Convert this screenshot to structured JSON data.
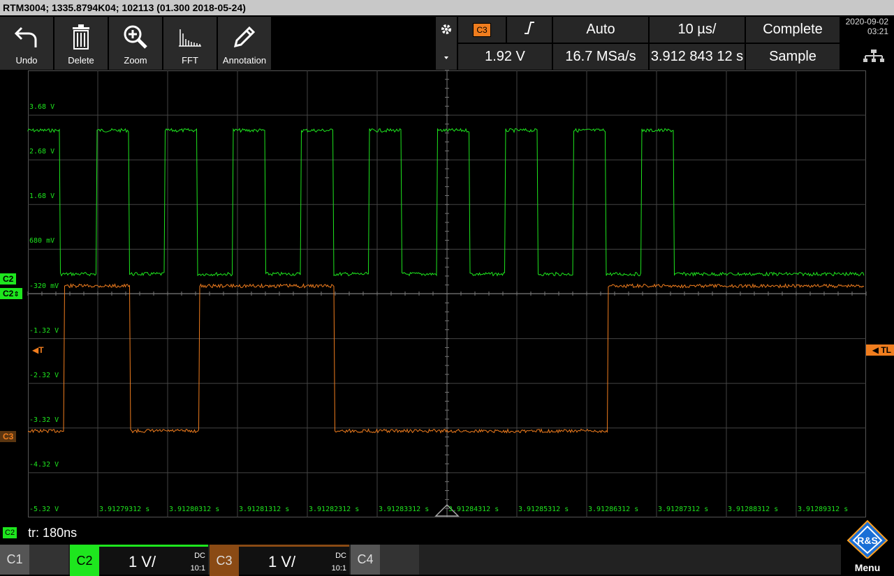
{
  "title": "RTM3004; 1335.8794K04; 102113 (01.300 2018-05-24)",
  "toolbar": [
    {
      "label": "Undo",
      "icon": "undo-icon"
    },
    {
      "label": "Delete",
      "icon": "trash-icon"
    },
    {
      "label": "Zoom",
      "icon": "zoom-icon"
    },
    {
      "label": "FFT",
      "icon": "fft-icon"
    },
    {
      "label": "Annotation",
      "icon": "pencil-icon"
    }
  ],
  "trigger": {
    "source": "C3",
    "level": "1.92 V",
    "mode": "Auto",
    "sample_rate": "16.7 MSa/s",
    "timebase": "10 µs/",
    "position": "3.912 843 12 s",
    "acq_state": "Complete",
    "acq_mode": "Sample"
  },
  "clock": {
    "date": "2020-09-02",
    "time": "03:21"
  },
  "y_labels": [
    "3.68 V",
    "2.68 V",
    "1.68 V",
    "680 mV",
    "-320 mV",
    "-1.32 V",
    "-2.32 V",
    "-3.32 V",
    "-4.32 V",
    "-5.32 V"
  ],
  "x_labels": [
    "3.91279312 s",
    "3.91280312 s",
    "3.91281312 s",
    "3.91282312 s",
    "3.91283312 s",
    "3.91284312 s",
    "3.91285312 s",
    "3.91286312 s",
    "3.91287312 s",
    "3.91288312 s",
    "3.91289312 s"
  ],
  "markers": {
    "c2": "C2",
    "c2b": "C2",
    "c3": "C3",
    "trigger": "T",
    "trigger_level": "TL"
  },
  "measurement": {
    "channel": "C2",
    "text": "tr: 180ns"
  },
  "channels": [
    {
      "name": "C1",
      "scale": "",
      "coupling": "",
      "probe": ""
    },
    {
      "name": "C2",
      "scale": "1 V/",
      "coupling": "DC",
      "probe": "10:1"
    },
    {
      "name": "C3",
      "scale": "1 V/",
      "coupling": "DC",
      "probe": "10:1"
    },
    {
      "name": "C4",
      "scale": "",
      "coupling": "",
      "probe": ""
    }
  ],
  "menu_label": "Menu",
  "colors": {
    "c2": "#1ee61e",
    "c3": "#f07d1e",
    "grid": "#444444"
  }
}
